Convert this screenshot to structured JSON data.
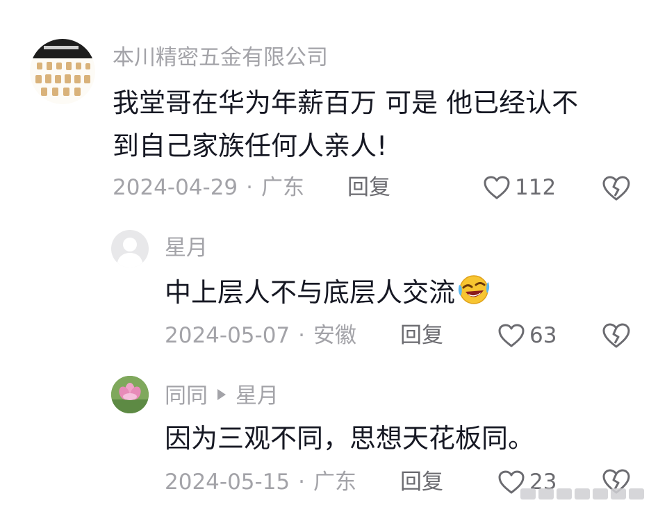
{
  "comments": [
    {
      "username": "本川精密五金有限公司",
      "text_line1": "我堂哥在华为年薪百万   可是 他已经认不",
      "text_line2": "到自己家族任何人亲人!",
      "date": "2024-04-29",
      "location": "广东",
      "reply_label": "回复",
      "likes": "112"
    },
    {
      "username": "星月",
      "text": "中上层人不与底层人交流",
      "date": "2024-05-07",
      "location": "安徽",
      "reply_label": "回复",
      "likes": "63"
    },
    {
      "username": "同同",
      "reply_to": "星月",
      "text": "因为三观不同，思想天花板同。",
      "date": "2024-05-15",
      "location": "广东",
      "reply_label": "回复",
      "likes": "23"
    }
  ],
  "separator": "·",
  "icons": {
    "like": "heart-outline-icon",
    "dislike": "broken-heart-icon",
    "laugh": "rofl-emoji-icon",
    "arrow": "triangle-right-icon"
  },
  "colors": {
    "text_primary": "#161823",
    "text_secondary": "#a3a3a8",
    "action": "#6b6b70"
  }
}
